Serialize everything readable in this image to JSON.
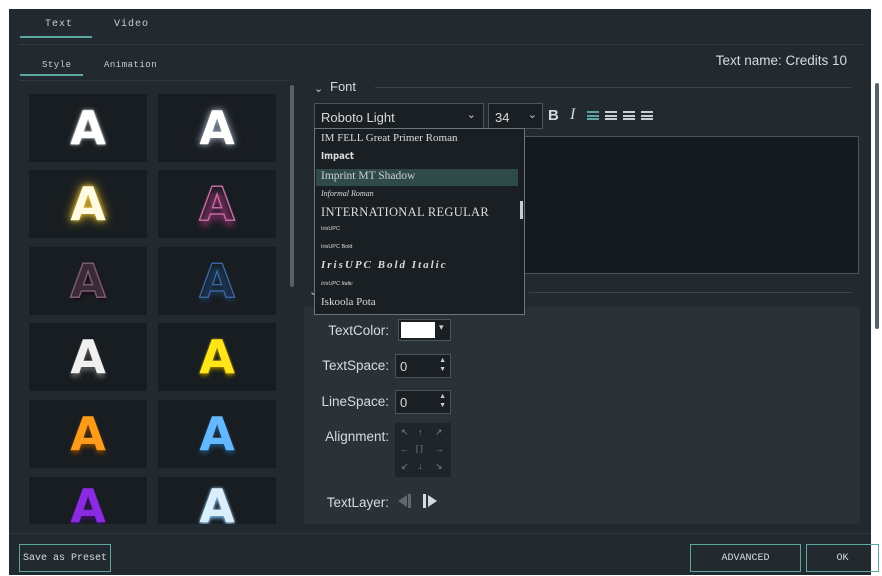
{
  "top_tabs": {
    "text": "Text",
    "video": "Video"
  },
  "sub_tabs": {
    "style": "Style",
    "animation": "Animation"
  },
  "text_name": "Text name: Credits 10",
  "font_section": "Font",
  "preset_glyph": "A",
  "presets_count": 12,
  "font": {
    "family": "Roboto Light",
    "size": "34",
    "bold": "B",
    "italic": "I",
    "dropdown": [
      "IM FELL Great Primer Roman",
      "Impact",
      "Imprint MT Shadow",
      "Informal Roman",
      "INTERNATIONAL REGULAR",
      "IrisUPC",
      "IrisUPC Bold",
      "IrisUPC Bold Italic",
      "IrisUPC Italic",
      "Iskoola Pota"
    ],
    "highlighted_index": 2
  },
  "settings": {
    "text_color_label": "TextColor:",
    "text_color": "#ffffff",
    "text_space_label": "TextSpace:",
    "text_space": "0",
    "line_space_label": "LineSpace:",
    "line_space": "0",
    "alignment_label": "Alignment:",
    "text_layer_label": "TextLayer:"
  },
  "buttons": {
    "save_preset": "Save as Preset",
    "advanced": "ADVANCED",
    "ok": "OK"
  },
  "colors": {
    "background": "#222a30",
    "accent": "#5da7a2",
    "panel": "#2a3238",
    "tile": "#181d21"
  }
}
